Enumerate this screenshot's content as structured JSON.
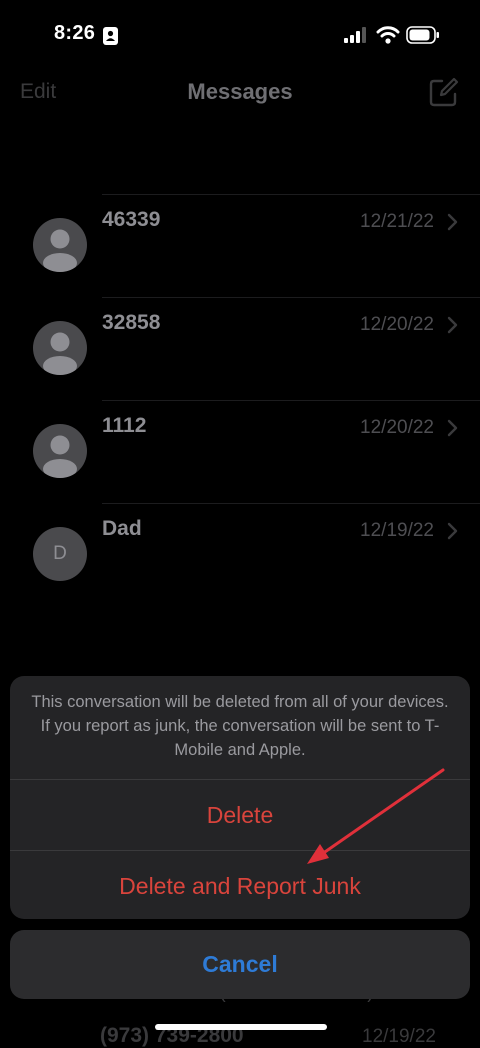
{
  "status_bar": {
    "time": "8:26"
  },
  "nav": {
    "edit_label": "Edit",
    "title": "Messages"
  },
  "conversations": [
    {
      "name": "46339",
      "date": "12/21/22",
      "avatar": "person-silhouette"
    },
    {
      "name": "32858",
      "date": "12/20/22",
      "avatar": "person-silhouette"
    },
    {
      "name": "1112",
      "date": "12/20/22",
      "avatar": "person-silhouette"
    },
    {
      "name": "Dad",
      "date": "12/19/22",
      "avatar": "initial",
      "initial": "D"
    }
  ],
  "action_sheet": {
    "message": "This conversation will be deleted from all of your devices. If you report as junk, the conversation will be sent to T-Mobile and Apple.",
    "delete_label": "Delete",
    "delete_report_label": "Delete and Report Junk",
    "cancel_label": "Cancel"
  },
  "background_peek": {
    "line1": "Dental Studio (Dr. Faver's office): Ju...",
    "line2": "(973) 739-2800",
    "date": "12/19/22"
  },
  "colors": {
    "destructive": "#d9443c",
    "cancel": "#2e7bd6",
    "annotation_arrow": "#e0303a"
  }
}
